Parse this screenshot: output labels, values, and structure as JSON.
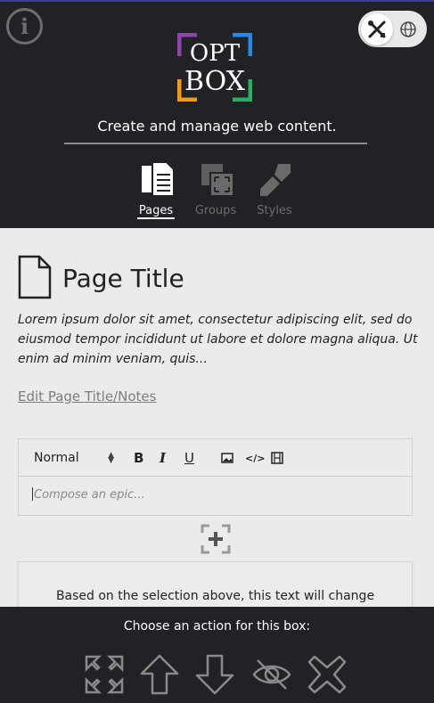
{
  "app": {
    "logo_line1": "OPT",
    "logo_line2": "BOX",
    "tagline": "Create and manage web content."
  },
  "header": {
    "info_icon": "info-icon",
    "mode_toggle": {
      "active": "tools-icon",
      "inactive": "globe-icon"
    }
  },
  "nav": {
    "items": [
      {
        "label": "Pages",
        "icon": "pages-icon",
        "active": true
      },
      {
        "label": "Groups",
        "icon": "groups-icon",
        "active": false
      },
      {
        "label": "Styles",
        "icon": "brush-icon",
        "active": false
      }
    ]
  },
  "page": {
    "title": "Page Title",
    "description": "Lorem ipsum dolor sit amet, consectetur adipiscing elit, sed do eiusmod tempor incididunt ut labore et dolore magna aliqua. Ut enim ad minim veniam, quis...",
    "edit_link": "Edit Page Title/Notes"
  },
  "editor": {
    "format_select": "Normal",
    "bold": "B",
    "italic": "I",
    "underline": "U",
    "placeholder": "Compose an epic..."
  },
  "preview": {
    "text": "Based on the selection above, this text will change"
  },
  "footer": {
    "title": "Choose an action for this box:",
    "actions": [
      "expand-icon",
      "move-up-icon",
      "move-down-icon",
      "hide-icon",
      "delete-icon"
    ]
  },
  "colors": {
    "header_bg": "#202226",
    "accent_top": "#3b3f8c",
    "logo_purple": "#8e44ad",
    "logo_blue": "#2e86de",
    "logo_orange": "#f39c12",
    "logo_green": "#27ae60"
  }
}
